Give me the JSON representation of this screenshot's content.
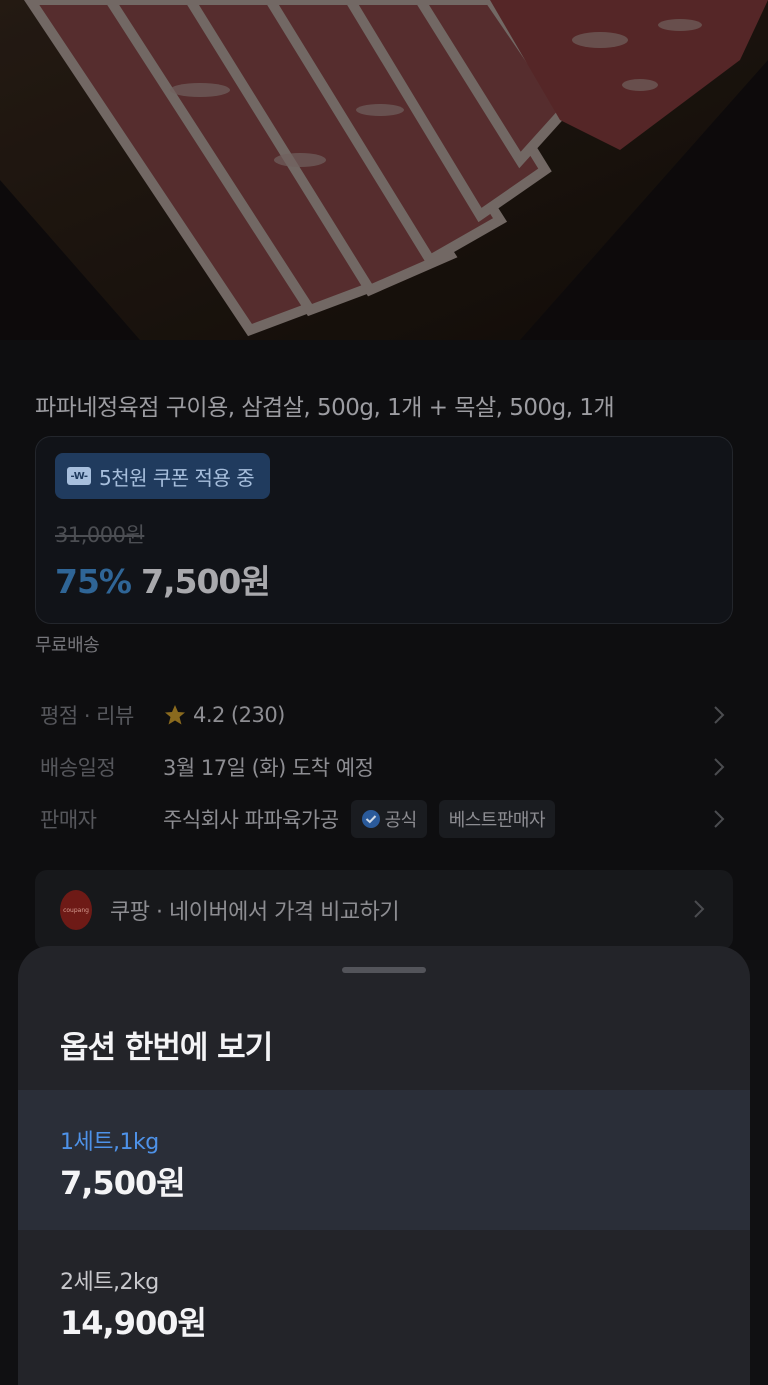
{
  "product": {
    "title": "파파네정육점 구이용, 삼겹살, 500g, 1개 + 목살, 500g, 1개"
  },
  "price_card": {
    "coupon_label": "5천원 쿠폰 적용 중",
    "coupon_icon_text": "-W-",
    "original_price": "31,000원",
    "discount_rate": "75%",
    "sale_price": "7,500원"
  },
  "shipping": {
    "free_label": "무료배송"
  },
  "details": {
    "rating": {
      "label": "평점 · 리뷰",
      "score": "4.2",
      "count": "(230)"
    },
    "delivery": {
      "label": "배송일정",
      "value": "3월 17일 (화) 도착 예정"
    },
    "seller": {
      "label": "판매자",
      "name": "주식회사 파파육가공",
      "official_tag": "공식",
      "best_tag": "베스트판매자"
    }
  },
  "compare": {
    "logo_text": "coupang",
    "label": "쿠팡 · 네이버에서 가격 비교하기"
  },
  "sheet": {
    "title": "옵션 한번에 보기",
    "options": [
      {
        "name": "1세트,1kg",
        "price": "7,500원",
        "selected": true
      },
      {
        "name": "2세트,2kg",
        "price": "14,900원",
        "selected": false
      }
    ]
  },
  "colors": {
    "accent_blue": "#4e92e8",
    "discount_blue": "#2f6596",
    "coupon_bg": "#203b5e",
    "sheet_bg": "#232429",
    "star": "#d9a521"
  },
  "icons": {
    "coupon": "ticket-icon",
    "star": "star-icon",
    "verified": "check-badge-icon",
    "chevron": "chevron-right-icon"
  }
}
